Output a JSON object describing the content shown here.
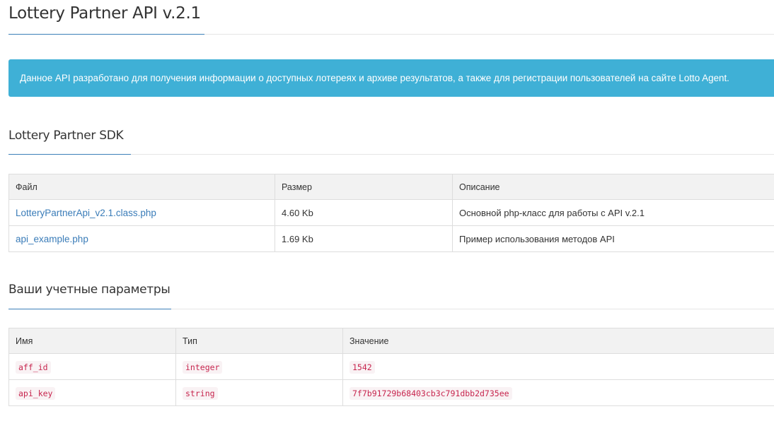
{
  "page": {
    "title": "Lottery Partner API v.2.1"
  },
  "alert": {
    "text": "Данное API разработано для получения информации о доступных лотереях и архиве результатов, а также для регистрации пользователей на сайте Lotto Agent."
  },
  "sdk": {
    "heading": "Lottery Partner SDK",
    "columns": [
      "Файл",
      "Размер",
      "Описание"
    ],
    "rows": [
      {
        "file": "LotteryPartnerApi_v2.1.class.php",
        "size": "4.60 Kb",
        "description": "Основной php-класс для работы с API v.2.1"
      },
      {
        "file": "api_example.php",
        "size": "1.69 Kb",
        "description": "Пример использования методов API"
      }
    ]
  },
  "credentials": {
    "heading": "Ваши учетные параметры",
    "columns": [
      "Имя",
      "Тип",
      "Значение"
    ],
    "rows": [
      {
        "name": "aff_id",
        "type": "integer",
        "value": "1542"
      },
      {
        "name": "api_key",
        "type": "string",
        "value": "7f7b91729b68403cb3c791dbb2d735ee"
      }
    ]
  },
  "colors": {
    "accent_link": "#3a7cb8",
    "alert_bg": "#3fb0d6",
    "code_text": "#c7254e",
    "code_bg": "#f9f2f4"
  }
}
